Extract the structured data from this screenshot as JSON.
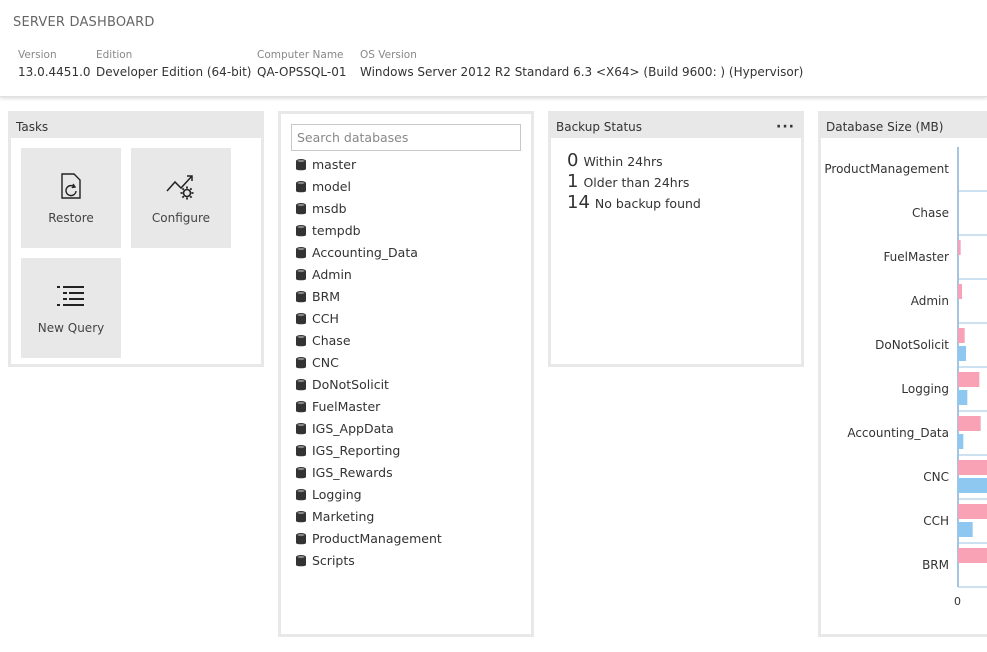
{
  "header": {
    "title": "SERVER DASHBOARD",
    "properties": [
      {
        "label": "Version",
        "value": "13.0.4451.0"
      },
      {
        "label": "Edition",
        "value": "Developer Edition (64-bit)"
      },
      {
        "label": "Computer Name",
        "value": "QA-OPSSQL-01"
      },
      {
        "label": "OS Version",
        "value": "Windows Server 2012 R2 Standard 6.3 <X64> (Build 9600: ) (Hypervisor)"
      }
    ]
  },
  "tasks": {
    "title": "Tasks",
    "items": [
      {
        "label": "Restore",
        "icon": "restore-icon"
      },
      {
        "label": "Configure",
        "icon": "configure-icon"
      },
      {
        "label": "New Query",
        "icon": "new-query-icon"
      }
    ]
  },
  "databases": {
    "search_placeholder": "Search databases",
    "items": [
      "master",
      "model",
      "msdb",
      "tempdb",
      "Accounting_Data",
      "Admin",
      "BRM",
      "CCH",
      "Chase",
      "CNC",
      "DoNotSolicit",
      "FuelMaster",
      "IGS_AppData",
      "IGS_Reporting",
      "IGS_Rewards",
      "Logging",
      "Marketing",
      "ProductManagement",
      "Scripts"
    ]
  },
  "backup": {
    "title": "Backup Status",
    "more_label": "···",
    "stats": [
      {
        "count": "0",
        "label": "Within 24hrs"
      },
      {
        "count": "1",
        "label": "Older than 24hrs"
      },
      {
        "count": "14",
        "label": "No backup found"
      }
    ]
  },
  "dbsize": {
    "title": "Database Size (MB)",
    "x_tick": "0",
    "colors": {
      "series_a": "#f9a1b5",
      "series_b": "#8ec8f0"
    }
  },
  "chart_data": {
    "type": "bar",
    "orientation": "horizontal",
    "title": "Database Size (MB)",
    "categories": [
      "ProductManagement",
      "Chase",
      "FuelMaster",
      "Admin",
      "DoNotSolicit",
      "Logging",
      "Accounting_Data",
      "CNC",
      "CCH",
      "BRM"
    ],
    "series": [
      {
        "values": [
          0,
          0,
          2,
          3,
          5,
          16,
          17,
          40,
          40,
          40
        ]
      },
      {
        "values": [
          0,
          0,
          0,
          0,
          6,
          7,
          4,
          40,
          11,
          0
        ]
      }
    ],
    "xlim": [
      0,
      30
    ],
    "x_ticks": [
      "0"
    ],
    "grid": true
  }
}
